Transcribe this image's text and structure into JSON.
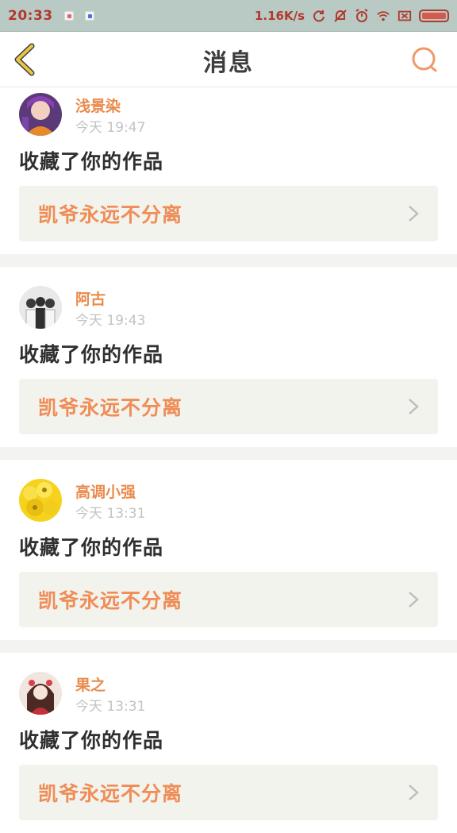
{
  "status_bar": {
    "time": "20:33",
    "net_speed": "1.16K/s"
  },
  "nav": {
    "title": "消息"
  },
  "messages": [
    {
      "username": "浅景染",
      "time": "今天 19:47",
      "action": "收藏了你的作品",
      "work_title": "凯爷永远不分离",
      "avatar": "anime-girl-avatar"
    },
    {
      "username": "阿古",
      "time": "今天 19:43",
      "action": "收藏了你的作品",
      "work_title": "凯爷永远不分离",
      "avatar": "group-photo-avatar"
    },
    {
      "username": "高调小强",
      "time": "今天 13:31",
      "action": "收藏了你的作品",
      "work_title": "凯爷永远不分离",
      "avatar": "yellow-flower-avatar"
    },
    {
      "username": "果之",
      "time": "今天 13:31",
      "action": "收藏了你的作品",
      "work_title": "凯爷永远不分离",
      "avatar": "illustrated-girl-avatar"
    }
  ],
  "colors": {
    "accent": "#ea8a4b",
    "back_arrow": "#e8c547",
    "card_bg": "#f3f3ed"
  }
}
